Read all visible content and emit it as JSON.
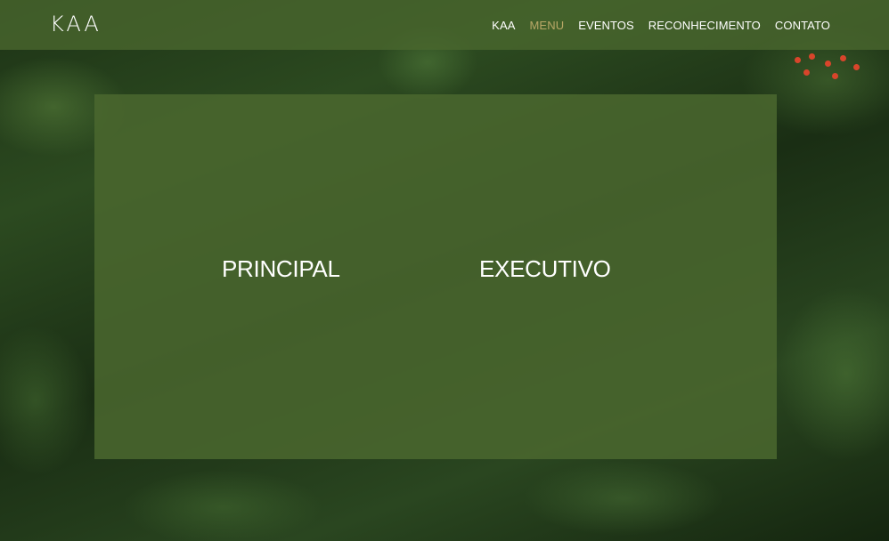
{
  "brand": {
    "logo_text": "KAA",
    "accent_color": "#b9a867",
    "overlay_color": "#4a682e"
  },
  "nav": {
    "items": [
      {
        "label": "KAA",
        "active": false
      },
      {
        "label": "MENU",
        "active": true
      },
      {
        "label": "EVENTOS",
        "active": false
      },
      {
        "label": "RECONHECIMENTO",
        "active": false
      },
      {
        "label": "CONTATO",
        "active": false
      }
    ]
  },
  "menu_panel": {
    "options": [
      {
        "label": "PRINCIPAL"
      },
      {
        "label": "EXECUTIVO"
      }
    ]
  },
  "background": {
    "icon": "fern-foliage-photo"
  }
}
